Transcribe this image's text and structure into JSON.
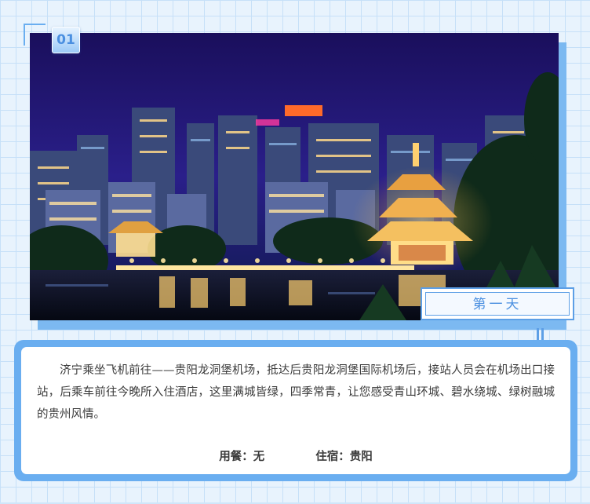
{
  "badge": {
    "number": "01"
  },
  "day": {
    "label": "第一天"
  },
  "description": "济宁乘坐飞机前往——贵阳龙洞堡机场，抵达后贵阳龙洞堡国际机场后，接站人员会在机场出口接站，后乘车前往今晚所入住酒店，这里满城皆绿，四季常青，让您感受青山环城、碧水绕城、绿树融城的贵州风情。",
  "meals": {
    "label": "用餐：",
    "value": "无"
  },
  "lodging": {
    "label": "住宿：",
    "value": "贵阳"
  },
  "photo": {
    "subject": "night-city-pavilion-photo"
  },
  "colors": {
    "accent": "#6aaef0",
    "accent_dark": "#5d9fe6",
    "grid_bg": "#e8f3fd",
    "text": "#3a3a3a"
  }
}
